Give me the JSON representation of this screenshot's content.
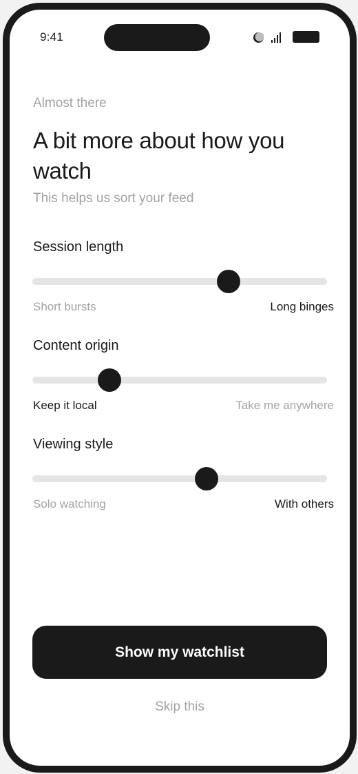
{
  "status_bar": {
    "time": "9:41",
    "icons": [
      "do-not-disturb-icon",
      "signal-icon",
      "battery-icon"
    ]
  },
  "header": {
    "eyebrow": "Almost there",
    "title": "A bit more about how you watch",
    "subtitle": "This helps us sort your feed"
  },
  "settings": [
    {
      "label": "Session length",
      "left_label": "Short bursts",
      "right_label": "Long binges",
      "value": 0.68,
      "leaning": "right"
    },
    {
      "label": "Content origin",
      "left_label": "Keep it local",
      "right_label": "Take me anywhere",
      "value": 0.24,
      "leaning": "left"
    },
    {
      "label": "Viewing style",
      "left_label": "Solo watching",
      "right_label": "With others",
      "value": 0.6,
      "leaning": "right"
    }
  ],
  "actions": {
    "primary_label": "Show my watchlist",
    "skip_label": "Skip this"
  },
  "colors": {
    "ink": "#1a1a1a",
    "muted": "#a3a3a3",
    "track": "#e5e5e5",
    "background": "#ffffff"
  }
}
